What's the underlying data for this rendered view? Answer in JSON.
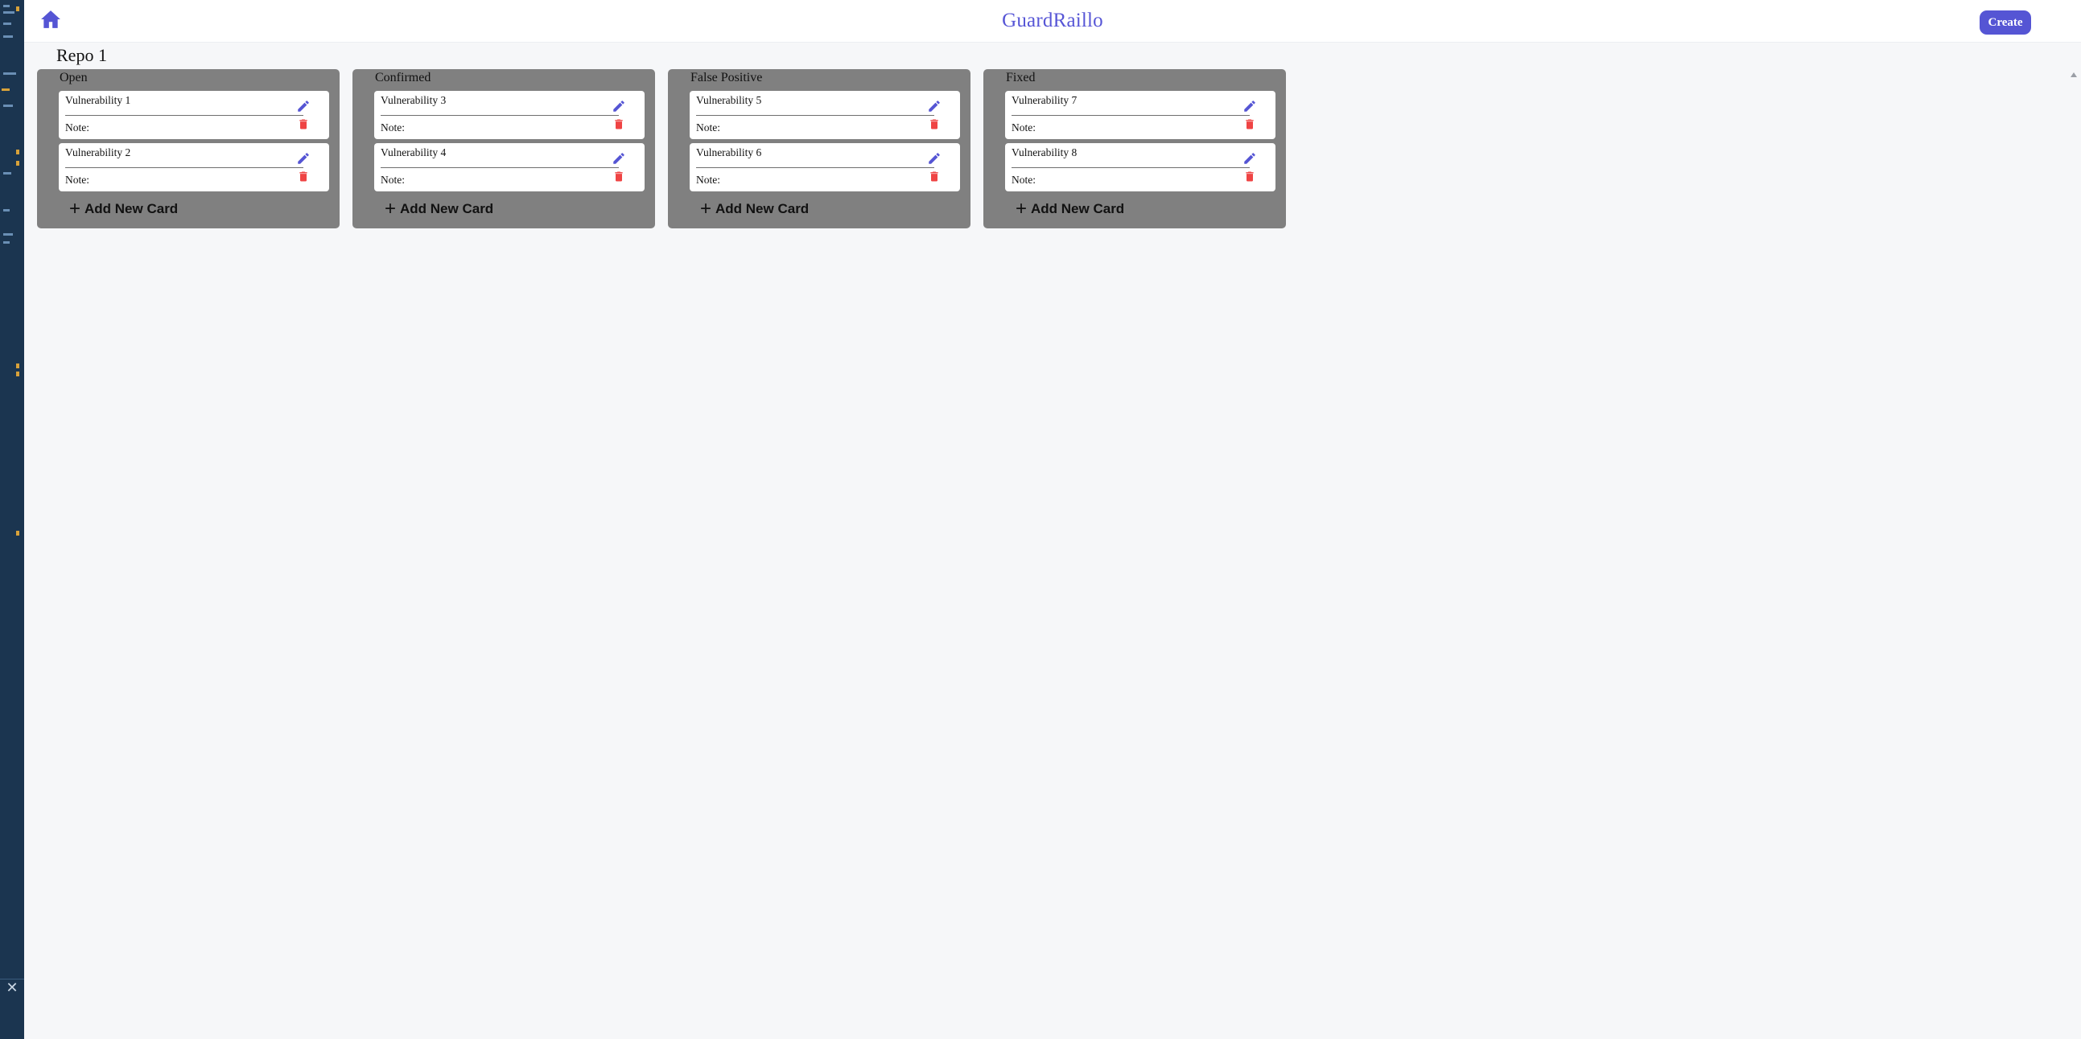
{
  "header": {
    "brand": "GuardRaillo",
    "create_label": "Create",
    "home_icon": "home-icon"
  },
  "board": {
    "title": "Repo 1",
    "add_card_label": "Add New Card",
    "columns": [
      {
        "title": "Open",
        "cards": [
          {
            "title": "Vulnerability 1",
            "note": "Note:"
          },
          {
            "title": "Vulnerability 2",
            "note": "Note:"
          }
        ]
      },
      {
        "title": "Confirmed",
        "cards": [
          {
            "title": "Vulnerability 3",
            "note": "Note:"
          },
          {
            "title": "Vulnerability 4",
            "note": "Note:"
          }
        ]
      },
      {
        "title": "False Positive",
        "cards": [
          {
            "title": "Vulnerability 5",
            "note": "Note:"
          },
          {
            "title": "Vulnerability 6",
            "note": "Note:"
          }
        ]
      },
      {
        "title": "Fixed",
        "cards": [
          {
            "title": "Vulnerability 7",
            "note": "Note:"
          },
          {
            "title": "Vulnerability 8",
            "note": "Note:"
          }
        ]
      }
    ]
  },
  "colors": {
    "accent": "#5555d4",
    "brand": "#5756d6",
    "column_bg": "#808080",
    "delete": "#ef4444",
    "page_bg": "#f6f7f9"
  },
  "icons": {
    "edit": "pencil-icon",
    "delete": "trash-icon",
    "add": "plus-icon",
    "close": "close-icon"
  }
}
